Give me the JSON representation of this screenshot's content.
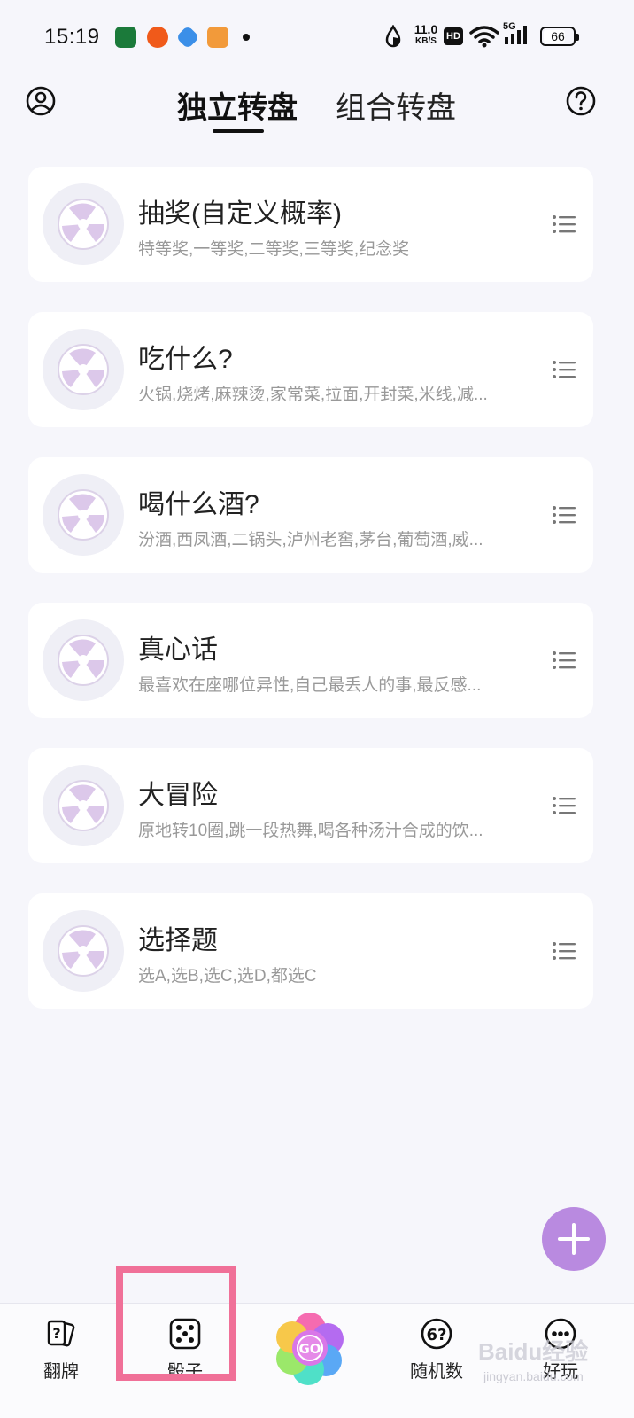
{
  "status_bar": {
    "time": "15:19",
    "net_speed_value": "11.0",
    "net_speed_unit": "KB/S",
    "hd": "HD",
    "network_type": "5G",
    "battery": "66"
  },
  "header": {
    "tabs": [
      {
        "label": "独立转盘",
        "active": true
      },
      {
        "label": "组合转盘",
        "active": false
      }
    ],
    "left_icon": "user-icon",
    "right_icon": "help-icon"
  },
  "wheels": [
    {
      "title": "抽奖(自定义概率)",
      "subtitle": "特等奖,一等奖,二等奖,三等奖,纪念奖"
    },
    {
      "title": "吃什么?",
      "subtitle": "火锅,烧烤,麻辣烫,家常菜,拉面,开封菜,米线,减..."
    },
    {
      "title": "喝什么酒?",
      "subtitle": "汾酒,西凤酒,二锅头,泸州老窖,茅台,葡萄酒,威..."
    },
    {
      "title": "真心话",
      "subtitle": "最喜欢在座哪位异性,自己最丢人的事,最反感..."
    },
    {
      "title": "大冒险",
      "subtitle": "原地转10圈,跳一段热舞,喝各种汤汁合成的饮..."
    },
    {
      "title": "选择题",
      "subtitle": "选A,选B,选C,选D,都选C"
    }
  ],
  "fab": {
    "icon": "plus-icon"
  },
  "bottom_nav": [
    {
      "label": "翻牌",
      "icon": "card-flip-icon"
    },
    {
      "label": "骰子",
      "icon": "dice-icon"
    },
    {
      "label": "GO",
      "icon": "flower-go-icon"
    },
    {
      "label": "随机数",
      "icon": "random-number-icon",
      "icon_text": "6?"
    },
    {
      "label": "好玩",
      "icon": "more-icon"
    }
  ],
  "watermark": {
    "text": "Baidu经验",
    "sub": "jingyan.baidu.com"
  },
  "colors": {
    "background": "#f6f6fb",
    "fab": "#b98ae0",
    "highlight": "#f07098",
    "wheel_petal": "#dcc8ea"
  }
}
